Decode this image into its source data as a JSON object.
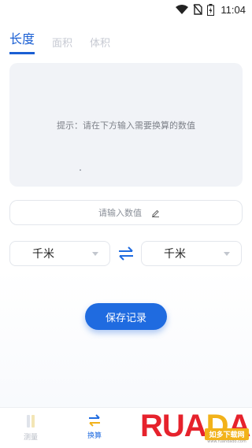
{
  "status": {
    "time": "11:04"
  },
  "tabs": [
    {
      "label": "长度"
    },
    {
      "label": "面积"
    },
    {
      "label": "体积"
    }
  ],
  "result": {
    "hint": "提示：请在下方输入需要换算的数值"
  },
  "input": {
    "placeholder": "请输入数值",
    "value": ""
  },
  "units": {
    "from": "千米",
    "to": "千米"
  },
  "save_label": "保存记录",
  "nav": [
    {
      "label": "测量"
    },
    {
      "label": "换算"
    }
  ],
  "watermark": {
    "brand": "RUANDADO",
    "sub": "如多下载网",
    "url": "www.ruandado.com"
  },
  "colors": {
    "accent": "#1f6be0",
    "tab_active": "#1a5fd3",
    "watermark_red": "#e6222c",
    "watermark_yellow": "#f2b21a"
  }
}
